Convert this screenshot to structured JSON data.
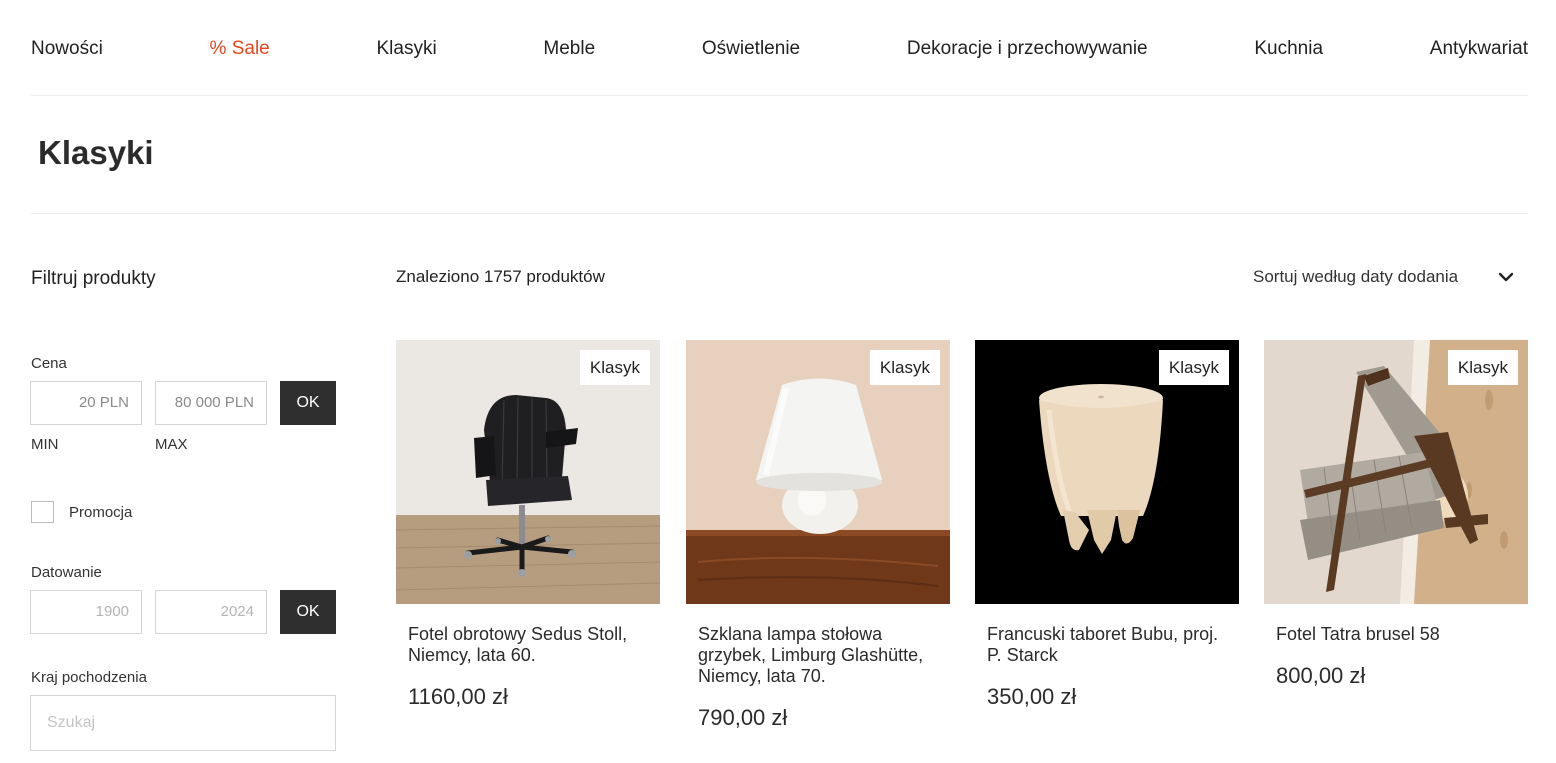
{
  "nav": {
    "items": [
      {
        "label": "Nowości"
      },
      {
        "label": "% Sale"
      },
      {
        "label": "Klasyki"
      },
      {
        "label": "Meble"
      },
      {
        "label": "Oświetlenie"
      },
      {
        "label": "Dekoracje i przechowywanie"
      },
      {
        "label": "Kuchnia"
      },
      {
        "label": "Antykwariat"
      }
    ],
    "sale_color": "#e8461e"
  },
  "page": {
    "title": "Klasyki"
  },
  "filters": {
    "heading": "Filtruj produkty",
    "price": {
      "label": "Cena",
      "min_value": "20 PLN",
      "max_value": "80 000 PLN",
      "min_label": "MIN",
      "max_label": "MAX",
      "ok_label": "OK"
    },
    "promo": {
      "label": "Promocja",
      "checked": false
    },
    "dating": {
      "label": "Datowanie",
      "min_placeholder": "1900",
      "max_placeholder": "2024",
      "ok_label": "OK"
    },
    "country": {
      "label": "Kraj pochodzenia",
      "placeholder": "Szukaj"
    }
  },
  "results": {
    "count_text": "Znaleziono 1757 produktów",
    "sort_label": "Sortuj według daty dodania",
    "sort_icon": "chevron-down-icon"
  },
  "products": [
    {
      "badge": "Klasyk",
      "name": "Fotel obrotowy Sedus Stoll, Niemcy, lata 60.",
      "price": "1160,00 zł"
    },
    {
      "badge": "Klasyk",
      "name": "Szklana lampa stołowa grzybek, Limburg Glashütte, Niemcy, lata 70.",
      "price": "790,00 zł"
    },
    {
      "badge": "Klasyk",
      "name": "Francuski taboret Bubu, proj. P. Starck",
      "price": "350,00 zł"
    },
    {
      "badge": "Klasyk",
      "name": "Fotel Tatra brusel 58",
      "price": "800,00 zł"
    }
  ]
}
